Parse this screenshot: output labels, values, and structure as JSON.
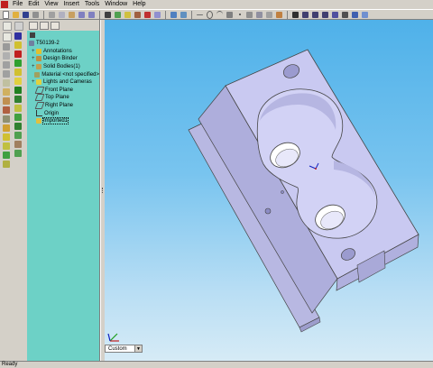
{
  "menu": {
    "items": [
      "File",
      "Edit",
      "View",
      "Insert",
      "Tools",
      "Window",
      "Help"
    ]
  },
  "tree": {
    "root": "T50139-2",
    "items": [
      {
        "label": "Annotations",
        "icon": "annotations-icon",
        "expandable": true
      },
      {
        "label": "Design Binder",
        "icon": "design-binder-icon",
        "expandable": true
      },
      {
        "label": "Solid Bodies(1)",
        "icon": "solid-bodies-icon",
        "expandable": true
      },
      {
        "label": "Material <not specified>",
        "icon": "material-icon",
        "expandable": false
      },
      {
        "label": "Lights and Cameras",
        "icon": "lights-icon",
        "expandable": true
      },
      {
        "label": "Front Plane",
        "icon": "plane-icon",
        "expandable": false
      },
      {
        "label": "Top Plane",
        "icon": "plane-icon",
        "expandable": false
      },
      {
        "label": "Right Plane",
        "icon": "plane-icon",
        "expandable": false
      },
      {
        "label": "Origin",
        "icon": "origin-icon",
        "expandable": false
      },
      {
        "label": "Imported1",
        "icon": "imported-feature-icon",
        "expandable": false
      }
    ]
  },
  "view_orientation": {
    "value": "Custom"
  },
  "status": {
    "text": "Ready"
  },
  "colors": {
    "feature_tree_bg": "#6dd1c6",
    "viewport_top": "#4fb1e9",
    "viewport_bottom": "#d6ebf6",
    "part": "#c9c9f1"
  }
}
